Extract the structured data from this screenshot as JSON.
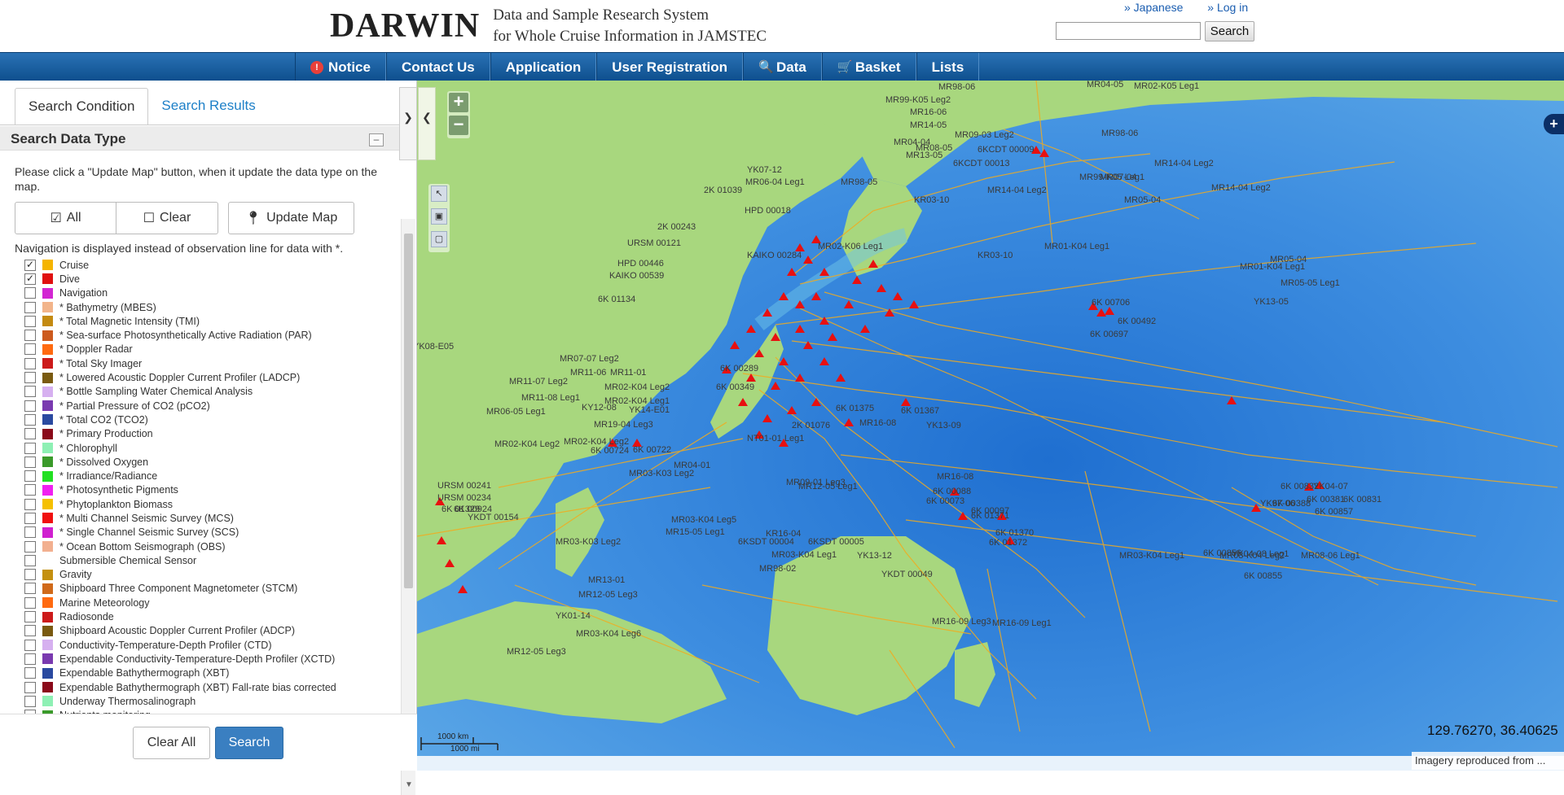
{
  "header": {
    "logo_text": "DARWIN",
    "logo_sub_line1": "Data and Sample Research System",
    "logo_sub_line2": "for Whole Cruise Information in JAMSTEC",
    "link_japanese": "» Japanese",
    "link_login": "» Log in",
    "search_value": "",
    "search_button": "Search"
  },
  "nav": {
    "items": [
      {
        "label": "Notice",
        "icon": "notice-icon"
      },
      {
        "label": "Contact Us"
      },
      {
        "label": "Application"
      },
      {
        "label": "User Registration"
      },
      {
        "label": "Data",
        "icon": "search-icon"
      },
      {
        "label": "Basket",
        "icon": "cart-icon"
      },
      {
        "label": "Lists"
      }
    ]
  },
  "panel": {
    "tab_condition": "Search Condition",
    "tab_results": "Search Results",
    "section_title": "Search Data Type",
    "collapse_symbol": "–",
    "instruction": "Please click a \"Update Map\" button, when it update the data type on the map.",
    "btn_all": "All",
    "btn_clear": "Clear",
    "btn_update": "Update Map",
    "nav_note": "Navigation is displayed instead of observation line for data with *.",
    "data_types": [
      {
        "label": "Cruise",
        "checked": true,
        "color": "#f5b400"
      },
      {
        "label": "Dive",
        "checked": true,
        "color": "#e01010"
      },
      {
        "label": "Navigation",
        "checked": false,
        "color": "#d226d2"
      },
      {
        "label": "* Bathymetry (MBES)",
        "checked": false,
        "color": "#f2b48a"
      },
      {
        "label": "* Total Magnetic Intensity (TMI)",
        "checked": false,
        "color": "#c48a10"
      },
      {
        "label": "* Sea-surface Photosynthetically Active Radiation (PAR)",
        "checked": false,
        "color": "#cc5a1e"
      },
      {
        "label": "* Doppler Radar",
        "checked": false,
        "color": "#ff6a10"
      },
      {
        "label": "* Total Sky Imager",
        "checked": false,
        "color": "#cc1a1a"
      },
      {
        "label": "* Lowered Acoustic Doppler Current Profiler (LADCP)",
        "checked": false,
        "color": "#7a5a10"
      },
      {
        "label": "* Bottle Sampling Water Chemical Analysis",
        "checked": false,
        "color": "#d6b0f0"
      },
      {
        "label": "* Partial Pressure of CO2 (pCO2)",
        "checked": false,
        "color": "#7a3ab0"
      },
      {
        "label": "* Total CO2 (TCO2)",
        "checked": false,
        "color": "#2a4aa0"
      },
      {
        "label": "* Primary Production",
        "checked": false,
        "color": "#8a0a1a"
      },
      {
        "label": "* Chlorophyll",
        "checked": false,
        "color": "#8ef0b4"
      },
      {
        "label": "* Dissolved Oxygen",
        "checked": false,
        "color": "#3a9a2a"
      },
      {
        "label": "* Irradiance/Radiance",
        "checked": false,
        "color": "#22e022"
      },
      {
        "label": "* Photosynthetic Pigments",
        "checked": false,
        "color": "#f020f0"
      },
      {
        "label": "* Phytoplankton Biomass",
        "checked": false,
        "color": "#f5c000"
      },
      {
        "label": "* Multi Channel Seismic Survey (MCS)",
        "checked": false,
        "color": "#f01010"
      },
      {
        "label": "* Single Channel Seismic Survey (SCS)",
        "checked": false,
        "color": "#d020d0"
      },
      {
        "label": "* Ocean Bottom Seismograph (OBS)",
        "checked": false,
        "color": "#f2b090"
      },
      {
        "label": "Submersible Chemical Sensor",
        "checked": false,
        "color": ""
      },
      {
        "label": "Gravity",
        "checked": false,
        "color": "#c49010"
      },
      {
        "label": "Shipboard Three Component Magnetometer (STCM)",
        "checked": false,
        "color": "#d06a1a"
      },
      {
        "label": "Marine Meteorology",
        "checked": false,
        "color": "#ff6a10"
      },
      {
        "label": "Radiosonde",
        "checked": false,
        "color": "#cc1a1a"
      },
      {
        "label": "Shipboard Acoustic Doppler Current Profiler (ADCP)",
        "checked": false,
        "color": "#7a5a10"
      },
      {
        "label": "Conductivity-Temperature-Depth Profiler (CTD)",
        "checked": false,
        "color": "#d6b0f0"
      },
      {
        "label": "Expendable Conductivity-Temperature-Depth Profiler (XCTD)",
        "checked": false,
        "color": "#7a3ab0"
      },
      {
        "label": "Expendable Bathythermograph (XBT)",
        "checked": false,
        "color": "#2a4aa0"
      },
      {
        "label": "Expendable Bathythermograph (XBT) Fall-rate bias corrected",
        "checked": false,
        "color": "#8a0a1a"
      },
      {
        "label": "Underway Thermosalinograph",
        "checked": false,
        "color": "#8ef0b4"
      },
      {
        "label": "Nutrients monitoring",
        "checked": false,
        "color": "#3a9a2a"
      }
    ],
    "btn_clear_all": "Clear All",
    "btn_search": "Search"
  },
  "map": {
    "coords": "129.76270, 36.40625",
    "attribution": "Imagery reproduced from ...",
    "scale_km": "1000 km",
    "scale_mi": "1000 mi",
    "labels": [
      "MR04-05",
      "MR02-K05 Leg1",
      "MR98-06",
      "MR99-K05 Leg2",
      "MR16-06",
      "MR14-05",
      "MR09-03 Leg2",
      "MR98-06",
      "MR04-04",
      "MR08-05",
      "MR13-05",
      "6KCDT 00009",
      "6KCDT 00013",
      "MR14-04 Leg2",
      "MR07-04",
      "MR99-K05 Leg1",
      "MR14-04 Leg2",
      "YK07-12",
      "MR06-04 Leg1",
      "2K 01039",
      "HPD 00018",
      "MR98-05",
      "MR14-04 Leg2",
      "KR03-10",
      "MR05-04",
      "2K 00243",
      "KR03-10",
      "URSM 00121",
      "KAIKO 00284",
      "MR02-K06 Leg1",
      "MR01-K04 Leg1",
      "HPD 00446",
      "KAIKO 00539",
      "MR05-04",
      "6K 01134",
      "MR01-K04 Leg1",
      "MR05-05 Leg1",
      "YK13-05",
      "6K 00706",
      "6K 00492",
      "6K 00697",
      "YK08-E05",
      "MR07-07 Leg2",
      "MR11-06",
      "MR11-01",
      "6K 00289",
      "MR11-07 Leg2",
      "MR02-K04 Leg2",
      "6K 00349",
      "MR11-08 Leg1",
      "KY12-08",
      "MR02-K04 Leg1",
      "YK14-E01",
      "6K 01375",
      "6K 01367",
      "MR06-05 Leg1",
      "MR02-K04 Leg2",
      "MR19-04 Leg3",
      "NT01-01 Leg1",
      "2K 01076",
      "MR16-08",
      "YK13-09",
      "MR02-K04 Leg2",
      "6K 00724",
      "6K 00722",
      "MR03-K03 Leg2",
      "MR04-01",
      "MR09-01 Leg3",
      "URSM 00241",
      "URSM 00234",
      "6K 01329",
      "MR12-05 Leg1",
      "MR16-08",
      "6K 00088",
      "6K 00097",
      "6K 00073",
      "MR03-K04 Leg5",
      "MR15-05 Leg1",
      "6K 00924",
      "YKDT 00154",
      "MR03-K03 Leg2",
      "6K 01371",
      "6K 01370",
      "6K 01372",
      "KR16-04",
      "6KSDT 00004",
      "6KSDT 00005",
      "MR03-K04 Leg1",
      "YK13-12",
      "YKDT 00049",
      "MR98-02",
      "MR13-01",
      "MR12-05 Leg3",
      "YK01-14",
      "MR03-K04 Leg6",
      "MR12-05 Leg3",
      "MR16-09 Leg3",
      "MR16-09 Leg1",
      "MR08-06 Leg1",
      "YK04-07",
      "6K 00832",
      "6K 00831",
      "6K 00381",
      "6K 00388",
      "6K 00857",
      "YK97-06",
      "YK04-08 Leg1",
      "MR03-K04 Leg2",
      "6K 00856",
      "6K 00855",
      "MR03-K04 Leg1"
    ]
  }
}
